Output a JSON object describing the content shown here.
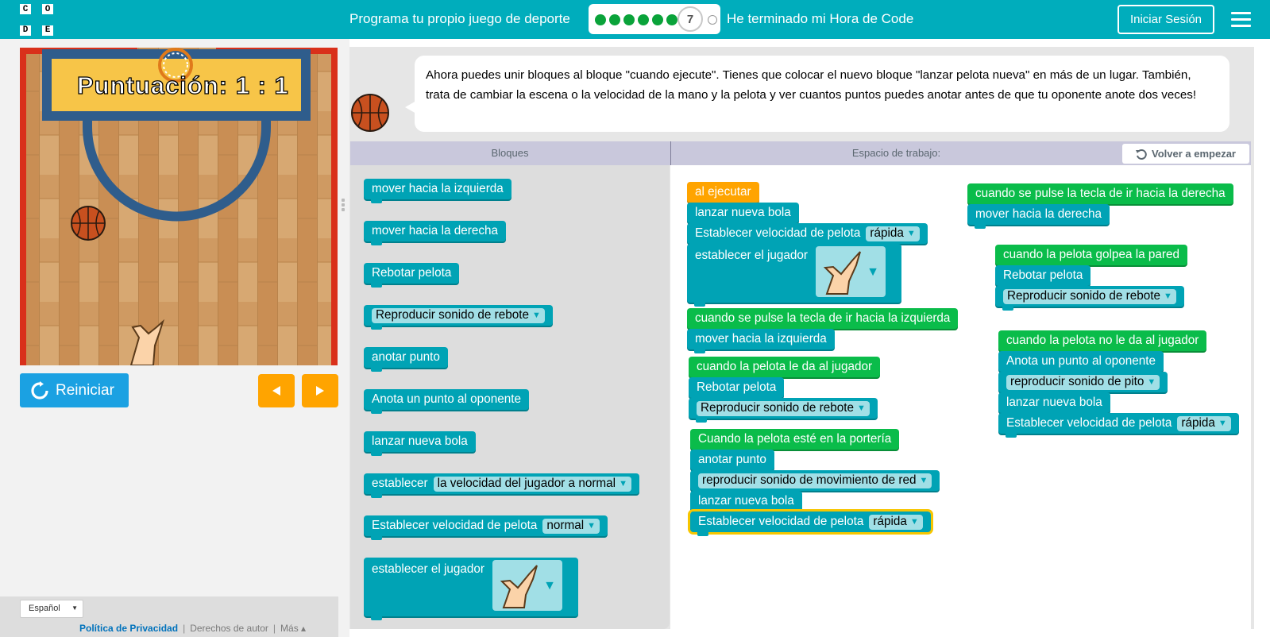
{
  "header": {
    "logo_letters": [
      "C",
      "O",
      "D",
      "E"
    ],
    "title": "Programa tu propio juego de deporte",
    "current_level": "7",
    "done_text": "He terminado mi Hora de Code",
    "signin_label": "Iniciar Sesión",
    "colors": {
      "bar": "#00adbc",
      "progress_done": "#0aa33a"
    }
  },
  "game": {
    "score_text": "Puntuación: 1 : 1"
  },
  "controls": {
    "reset_label": "Reiniciar",
    "left_icon": "arrow-left-icon",
    "right_icon": "arrow-right-icon"
  },
  "footer": {
    "language": "Español",
    "privacy": "Política de Privacidad",
    "copyright": "Derechos de autor",
    "more": "Más"
  },
  "instructions": {
    "text": "Ahora puedes unir bloques al bloque \"cuando ejecute\". Tienes que colocar el nuevo bloque \"lanzar pelota nueva\" en más de un lugar. También, trata de cambiar la escena o la velocidad de la mano y la pelota y ver cuantos puntos puedes anotar antes de que tu oponente anote dos veces!"
  },
  "workspace_header": {
    "blocks_label": "Bloques",
    "workspace_label": "Espacio de trabajo:",
    "restart_label": "Volver a empezar"
  },
  "toolbox": {
    "b1": "mover hacia la izquierda",
    "b2": "mover hacia la derecha",
    "b3": "Rebotar pelota",
    "b4": "Reproducir sonido de rebote",
    "b5": "anotar punto",
    "b6": "Anota un punto al oponente",
    "b7": "lanzar nueva bola",
    "b8_label": "establecer",
    "b8_value": "la velocidad del jugador a normal",
    "b9_label": "Establecer velocidad de pelota",
    "b9_value": "normal",
    "b10": "establecer el jugador"
  },
  "workspace": {
    "g1": {
      "head": "al ejecutar",
      "s1": "lanzar nueva bola",
      "s2_label": "Establecer velocidad de pelota",
      "s2_value": "rápida",
      "s3": "establecer el jugador"
    },
    "g2": {
      "head": "cuando se pulse la tecla de ir hacia la izquierda",
      "s1": "mover hacia la izquierda"
    },
    "g3": {
      "head": "cuando la pelota le da al jugador",
      "s1": "Rebotar pelota",
      "s2": "Reproducir sonido de rebote"
    },
    "g4": {
      "head": "Cuando la pelota esté en la portería",
      "s1": "anotar punto",
      "s2": "reproducir sonido de movimiento de red",
      "s3": "lanzar nueva bola",
      "s4_label": "Establecer velocidad de pelota",
      "s4_value": "rápida"
    },
    "g5": {
      "head": "cuando se pulse la tecla de ir hacia la derecha",
      "s1": "mover hacia la derecha"
    },
    "g6": {
      "head": "cuando la pelota golpea la pared",
      "s1": "Rebotar pelota",
      "s2": "Reproducir sonido de rebote"
    },
    "g7": {
      "head": "cuando la pelota no le da al jugador",
      "s1": "Anota un punto al oponente",
      "s2": "reproducir sonido de pito",
      "s3": "lanzar nueva bola",
      "s4_label": "Establecer velocidad de pelota",
      "s4_value": "rápida"
    }
  },
  "colors": {
    "action_block": "#00a3b5",
    "event_block": "#0abc4a",
    "run_block": "#ffa400",
    "reset_button": "#1ba1e2",
    "arrow_buttons": "#ffa400"
  }
}
